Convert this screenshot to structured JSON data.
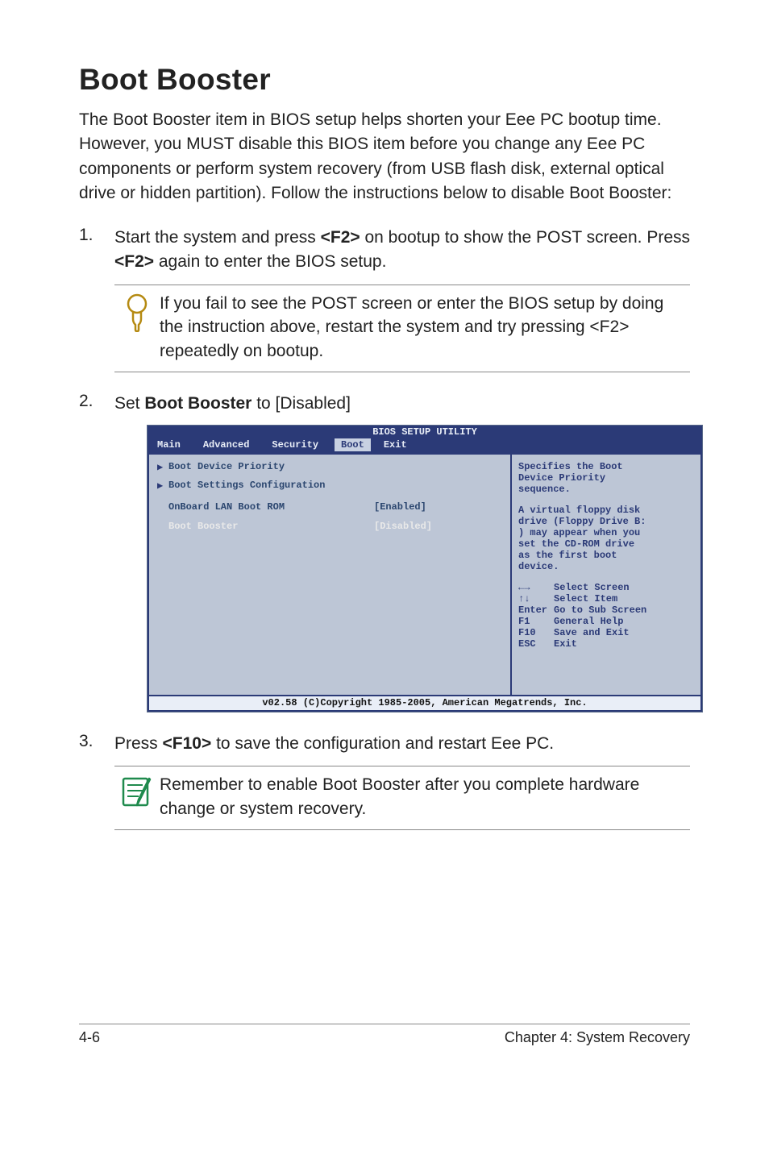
{
  "heading": "Boot Booster",
  "intro": "The Boot Booster item in BIOS setup helps shorten your Eee PC bootup time. However, you MUST disable this BIOS item before you change any Eee PC components or perform system recovery (from USB flash disk, external optical drive or hidden partition). Follow the instructions below to disable Boot Booster:",
  "steps": {
    "s1": {
      "num": "1.",
      "text_a": "Start the system and press ",
      "key_a": "<F2>",
      "text_b": " on bootup to show the POST screen. Press ",
      "key_b": "<F2>",
      "text_c": " again to enter the BIOS setup."
    },
    "s2": {
      "num": "2.",
      "text_a": "Set ",
      "bold": "Boot Booster",
      "text_b": " to [Disabled]"
    },
    "s3": {
      "num": "3.",
      "text_a": "Press ",
      "key_a": "<F10>",
      "text_b": " to save the configuration and restart Eee PC."
    }
  },
  "note1": "If you fail to see the POST screen or enter the BIOS setup by doing the instruction above, restart the system and try pressing <F2> repeatedly on bootup.",
  "note2": "Remember to enable Boot Booster after you complete hardware change or system recovery.",
  "bios": {
    "title": "BIOS SETUP UTILITY",
    "tabs": {
      "t1": "Main",
      "t2": "Advanced",
      "t3": "Security",
      "t4": "Boot",
      "t5": "Exit"
    },
    "left": {
      "r1": "Boot Device Priority",
      "r2": "Boot Settings Configuration",
      "r3k": "OnBoard LAN Boot ROM",
      "r3v": "[Enabled]",
      "r4k": "Boot Booster",
      "r4v": "[Disabled]"
    },
    "right": {
      "l1": "Specifies the Boot",
      "l2": "Device Priority",
      "l3": "sequence.",
      "l4": "A virtual floppy disk",
      "l5": "drive (Floppy Drive B:",
      "l6": ") may appear when you",
      "l7": "set the CD-ROM drive",
      "l8": "as the first boot",
      "l9": "device.",
      "h1k": "←→",
      "h1v": "Select Screen",
      "h2k": "↑↓",
      "h2v": "Select Item",
      "h3k": "Enter",
      "h3v": "Go to Sub Screen",
      "h4k": "F1",
      "h4v": "General Help",
      "h5k": "F10",
      "h5v": "Save and Exit",
      "h6k": "ESC",
      "h6v": "Exit"
    },
    "footer": "v02.58 (C)Copyright 1985-2005, American Megatrends, Inc."
  },
  "pgfoot": {
    "left": "4-6",
    "right": "Chapter 4: System Recovery"
  }
}
